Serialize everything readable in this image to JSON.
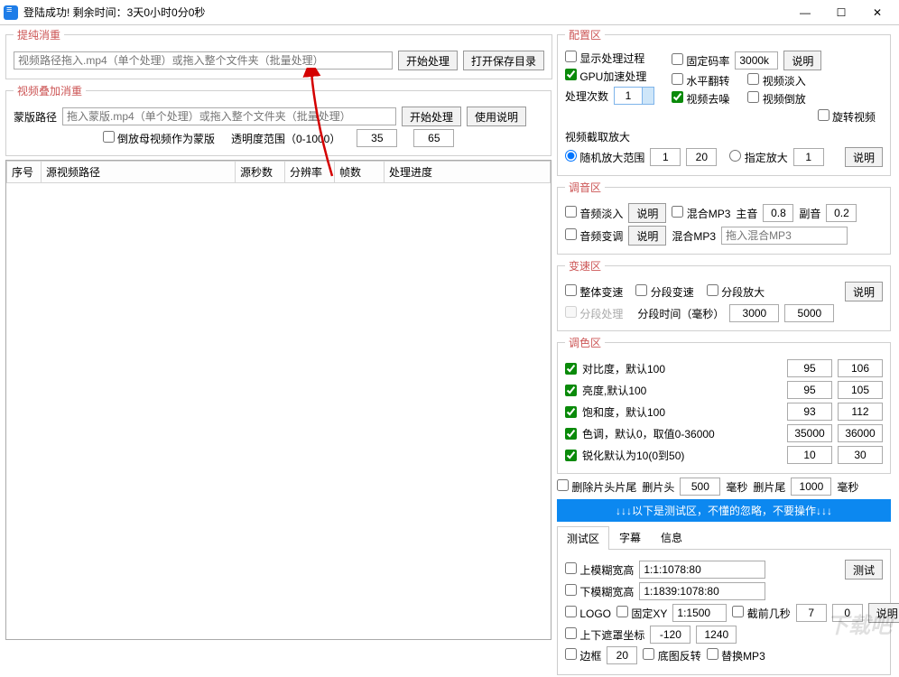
{
  "titlebar": {
    "title": "登陆成功! 剩余时间：3天0小时0分0秒"
  },
  "pure": {
    "legend": "提纯消重",
    "path_placeholder": "视频路径拖入.mp4（单个处理）或拖入整个文件夹（批量处理）",
    "start": "开始处理",
    "open_dir": "打开保存目录"
  },
  "overlay": {
    "legend": "视频叠加消重",
    "mask_label": "蒙版路径",
    "mask_placeholder": "拖入蒙版.mp4（单个处理）或拖入整个文件夹（批量处理）",
    "start": "开始处理",
    "manual": "使用说明",
    "reverse_cb": "倒放母视频作为蒙版",
    "opacity_label": "透明度范围（0-1000）",
    "opacity_min": "35",
    "opacity_max": "65"
  },
  "table": {
    "h1": "序号",
    "h2": "源视频路径",
    "h3": "源秒数",
    "h4": "分辨率",
    "h5": "帧数",
    "h6": "处理进度"
  },
  "config": {
    "legend": "配置区",
    "show_process": "显示处理过程",
    "gpu": "GPU加速处理",
    "count_label": "处理次数",
    "count": "1",
    "fixed_rate": "固定码率",
    "rate": "3000k",
    "explain": "说明",
    "hflip": "水平翻转",
    "fade_in": "视频淡入",
    "denoise": "视频去噪",
    "reverse": "视频倒放",
    "rotate": "旋转视频"
  },
  "crop": {
    "label": "视频截取放大",
    "random": "随机放大范围",
    "r1": "1",
    "r2": "20",
    "fixed": "指定放大",
    "f1": "1",
    "explain": "说明"
  },
  "audio": {
    "legend": "调音区",
    "fade": "音频淡入",
    "explain": "说明",
    "mix": "混合MP3",
    "main_label": "主音",
    "main": "0.8",
    "sub_label": "副音",
    "sub": "0.2",
    "pitch": "音频变调",
    "mix_label": "混合MP3",
    "mix_placeholder": "拖入混合MP3"
  },
  "speed": {
    "legend": "变速区",
    "whole": "整体变速",
    "seg": "分段变速",
    "zoom": "分段放大",
    "explain": "说明",
    "seg_proc": "分段处理",
    "time_label": "分段时间（毫秒）",
    "t1": "3000",
    "t2": "5000"
  },
  "color": {
    "legend": "调色区",
    "contrast": "对比度，默认100",
    "c1": "95",
    "c2": "106",
    "bright": "亮度,默认100",
    "b1": "95",
    "b2": "105",
    "sat": "饱和度，默认100",
    "s1": "93",
    "s2": "112",
    "hue": "色调，默认0，取值0-36000",
    "h1": "35000",
    "h2": "36000",
    "sharp": "锐化默认为10(0到50)",
    "sh1": "10",
    "sh2": "30"
  },
  "trim": {
    "cb": "删除片头片尾",
    "head_label": "删片头",
    "head": "500",
    "ms": "毫秒",
    "tail_label": "删片尾",
    "tail": "1000"
  },
  "banner": "↓↓↓以下是测试区，不懂的忽略，不要操作↓↓↓",
  "tabs": {
    "t1": "测试区",
    "t2": "字幕",
    "t3": "信息"
  },
  "test": {
    "upper": "上模糊宽高",
    "upper_v": "1:1:1078:80",
    "test_btn": "测试",
    "lower": "下模糊宽高",
    "lower_v": "1:1839:1078:80",
    "logo": "LOGO",
    "fixxy": "固定XY",
    "fixxy_v": "1:1500",
    "skip": "截前几秒",
    "skip1": "7",
    "skip2": "0",
    "explain": "说明",
    "mask_coord": "上下遮罩坐标",
    "mc1": "-120",
    "mc2": "1240",
    "border": "边框",
    "border_v": "20",
    "flip": "底图反转",
    "replace": "替换MP3"
  },
  "watermark": "下载吧"
}
